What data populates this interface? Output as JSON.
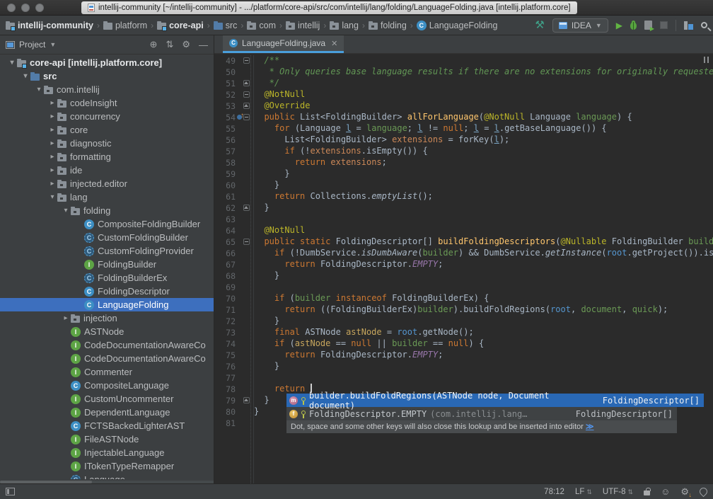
{
  "window": {
    "title": "intellij-community [~/intellij-community] - .../platform/core-api/src/com/intellij/lang/folding/LanguageFolding.java [intellij.platform.core]"
  },
  "navbar": {
    "crumbs": [
      {
        "label": "intellij-community",
        "icon": "module",
        "bold": true
      },
      {
        "label": "platform",
        "icon": "folder",
        "bold": false
      },
      {
        "label": "core-api",
        "icon": "module",
        "bold": true
      },
      {
        "label": "src",
        "icon": "folder-src",
        "bold": false
      },
      {
        "label": "com",
        "icon": "package",
        "bold": false
      },
      {
        "label": "intellij",
        "icon": "package",
        "bold": false
      },
      {
        "label": "lang",
        "icon": "package",
        "bold": false
      },
      {
        "label": "folding",
        "icon": "package",
        "bold": false
      },
      {
        "label": "LanguageFolding",
        "icon": "class",
        "bold": false
      }
    ],
    "run_config": "IDEA",
    "toolbar_icons": [
      "build-hammer-icon",
      "run-config-chip",
      "run-icon",
      "debug-icon",
      "coverage-icon",
      "stop-icon",
      "project-structure-icon",
      "search-icon"
    ]
  },
  "project_panel": {
    "header": {
      "title": "Project",
      "icons": [
        "locate-icon",
        "collapse-all-icon",
        "settings-gear-icon",
        "hide-icon"
      ]
    },
    "tree": [
      {
        "label": "core-api [intellij.platform.core]",
        "icon": "module",
        "level": 0,
        "arrow": "expanded",
        "bold": true,
        "selected": false
      },
      {
        "label": "src",
        "icon": "folder-src",
        "level": 1,
        "arrow": "expanded",
        "bold": true,
        "selected": false
      },
      {
        "label": "com.intellij",
        "icon": "package",
        "level": 2,
        "arrow": "expanded",
        "bold": false,
        "selected": false
      },
      {
        "label": "codeInsight",
        "icon": "package",
        "level": 3,
        "arrow": "collapsed",
        "bold": false,
        "selected": false
      },
      {
        "label": "concurrency",
        "icon": "package",
        "level": 3,
        "arrow": "collapsed",
        "bold": false,
        "selected": false
      },
      {
        "label": "core",
        "icon": "package",
        "level": 3,
        "arrow": "collapsed",
        "bold": false,
        "selected": false
      },
      {
        "label": "diagnostic",
        "icon": "package",
        "level": 3,
        "arrow": "collapsed",
        "bold": false,
        "selected": false
      },
      {
        "label": "formatting",
        "icon": "package",
        "level": 3,
        "arrow": "collapsed",
        "bold": false,
        "selected": false
      },
      {
        "label": "ide",
        "icon": "package",
        "level": 3,
        "arrow": "collapsed",
        "bold": false,
        "selected": false
      },
      {
        "label": "injected.editor",
        "icon": "package",
        "level": 3,
        "arrow": "collapsed",
        "bold": false,
        "selected": false
      },
      {
        "label": "lang",
        "icon": "package",
        "level": 3,
        "arrow": "expanded",
        "bold": false,
        "selected": false
      },
      {
        "label": "folding",
        "icon": "package",
        "level": 4,
        "arrow": "expanded",
        "bold": false,
        "selected": false
      },
      {
        "label": "CompositeFoldingBuilder",
        "icon": "class",
        "level": 5,
        "arrow": "none",
        "bold": false,
        "selected": false
      },
      {
        "label": "CustomFoldingBuilder",
        "icon": "class-abstract",
        "level": 5,
        "arrow": "none",
        "bold": false,
        "selected": false
      },
      {
        "label": "CustomFoldingProvider",
        "icon": "class-abstract",
        "level": 5,
        "arrow": "none",
        "bold": false,
        "selected": false
      },
      {
        "label": "FoldingBuilder",
        "icon": "interface",
        "level": 5,
        "arrow": "none",
        "bold": false,
        "selected": false
      },
      {
        "label": "FoldingBuilderEx",
        "icon": "class-abstract",
        "level": 5,
        "arrow": "none",
        "bold": false,
        "selected": false
      },
      {
        "label": "FoldingDescriptor",
        "icon": "class",
        "level": 5,
        "arrow": "none",
        "bold": false,
        "selected": false
      },
      {
        "label": "LanguageFolding",
        "icon": "class",
        "level": 5,
        "arrow": "none",
        "bold": false,
        "selected": true
      },
      {
        "label": "injection",
        "icon": "package",
        "level": 4,
        "arrow": "collapsed",
        "bold": false,
        "selected": false
      },
      {
        "label": "ASTNode",
        "icon": "interface",
        "level": 4,
        "arrow": "none",
        "bold": false,
        "selected": false
      },
      {
        "label": "CodeDocumentationAwareCo",
        "icon": "interface",
        "level": 4,
        "arrow": "none",
        "bold": false,
        "selected": false
      },
      {
        "label": "CodeDocumentationAwareCo",
        "icon": "interface",
        "level": 4,
        "arrow": "none",
        "bold": false,
        "selected": false
      },
      {
        "label": "Commenter",
        "icon": "interface",
        "level": 4,
        "arrow": "none",
        "bold": false,
        "selected": false
      },
      {
        "label": "CompositeLanguage",
        "icon": "class",
        "level": 4,
        "arrow": "none",
        "bold": false,
        "selected": false
      },
      {
        "label": "CustomUncommenter",
        "icon": "interface",
        "level": 4,
        "arrow": "none",
        "bold": false,
        "selected": false
      },
      {
        "label": "DependentLanguage",
        "icon": "interface",
        "level": 4,
        "arrow": "none",
        "bold": false,
        "selected": false
      },
      {
        "label": "FCTSBackedLighterAST",
        "icon": "class",
        "level": 4,
        "arrow": "none",
        "bold": false,
        "selected": false
      },
      {
        "label": "FileASTNode",
        "icon": "interface",
        "level": 4,
        "arrow": "none",
        "bold": false,
        "selected": false
      },
      {
        "label": "InjectableLanguage",
        "icon": "interface",
        "level": 4,
        "arrow": "none",
        "bold": false,
        "selected": false
      },
      {
        "label": "ITokenTypeRemapper",
        "icon": "interface",
        "level": 4,
        "arrow": "none",
        "bold": false,
        "selected": false
      },
      {
        "label": "Language",
        "icon": "class-abstract",
        "level": 4,
        "arrow": "none",
        "bold": false,
        "selected": false
      }
    ]
  },
  "editor": {
    "tab": {
      "label": "LanguageFolding.java"
    },
    "lines": [
      {
        "n": 49,
        "fold": "s",
        "tokens": [
          [
            "  /**",
            "d"
          ]
        ]
      },
      {
        "n": 50,
        "fold": "",
        "tokens": [
          [
            "   * Only queries base language results if there are no extensions for originally requested",
            "d"
          ]
        ]
      },
      {
        "n": 51,
        "fold": "e",
        "tokens": [
          [
            "   */",
            "d"
          ]
        ]
      },
      {
        "n": 52,
        "fold": "s",
        "tokens": [
          [
            "  ",
            "p"
          ],
          [
            "@NotNull",
            "a"
          ]
        ]
      },
      {
        "n": 53,
        "fold": "e",
        "tokens": [
          [
            "  ",
            "p"
          ],
          [
            "@Override",
            "a"
          ]
        ]
      },
      {
        "n": 54,
        "fold": "s",
        "override": true,
        "tokens": [
          [
            "  ",
            "p"
          ],
          [
            "public",
            "k"
          ],
          [
            " List<FoldingBuilder> ",
            "p"
          ],
          [
            "allForLanguage",
            "m"
          ],
          [
            "(",
            "p"
          ],
          [
            "@NotNull",
            "a"
          ],
          [
            " Language ",
            "p"
          ],
          [
            "language",
            "g"
          ],
          [
            ") {",
            "p"
          ]
        ]
      },
      {
        "n": 55,
        "fold": "",
        "tokens": [
          [
            "    ",
            "p"
          ],
          [
            "for",
            "k"
          ],
          [
            " (Language ",
            "p"
          ],
          [
            "l",
            "t"
          ],
          [
            " = ",
            "p"
          ],
          [
            "language",
            "g"
          ],
          [
            "; ",
            "p"
          ],
          [
            "l",
            "t"
          ],
          [
            " != ",
            "p"
          ],
          [
            "null",
            "k"
          ],
          [
            "; ",
            "p"
          ],
          [
            "l",
            "t"
          ],
          [
            " = ",
            "p"
          ],
          [
            "l",
            "t"
          ],
          [
            ".getBaseLanguage()) {",
            "p"
          ]
        ]
      },
      {
        "n": 56,
        "fold": "",
        "tokens": [
          [
            "      List<FoldingBuilder> ",
            "p"
          ],
          [
            "extensions",
            "o"
          ],
          [
            " = forKey(",
            "p"
          ],
          [
            "l",
            "t"
          ],
          [
            ");",
            "p"
          ]
        ]
      },
      {
        "n": 57,
        "fold": "",
        "tokens": [
          [
            "      ",
            "p"
          ],
          [
            "if",
            "k"
          ],
          [
            " (!",
            "p"
          ],
          [
            "extensions",
            "o"
          ],
          [
            ".isEmpty()) {",
            "p"
          ]
        ]
      },
      {
        "n": 58,
        "fold": "",
        "tokens": [
          [
            "        ",
            "p"
          ],
          [
            "return",
            "k"
          ],
          [
            " ",
            "p"
          ],
          [
            "extensions",
            "o"
          ],
          [
            ";",
            "p"
          ]
        ]
      },
      {
        "n": 59,
        "fold": "",
        "tokens": [
          [
            "      }",
            "p"
          ]
        ]
      },
      {
        "n": 60,
        "fold": "",
        "tokens": [
          [
            "    }",
            "p"
          ]
        ]
      },
      {
        "n": 61,
        "fold": "",
        "tokens": [
          [
            "    ",
            "p"
          ],
          [
            "return",
            "k"
          ],
          [
            " Collections.",
            "p"
          ],
          [
            "emptyList",
            "i"
          ],
          [
            "();",
            "p"
          ]
        ]
      },
      {
        "n": 62,
        "fold": "e",
        "tokens": [
          [
            "  }",
            "p"
          ]
        ]
      },
      {
        "n": 63,
        "fold": "",
        "tokens": []
      },
      {
        "n": 64,
        "fold": "",
        "tokens": [
          [
            "  ",
            "p"
          ],
          [
            "@NotNull",
            "a"
          ]
        ]
      },
      {
        "n": 65,
        "fold": "s",
        "tokens": [
          [
            "  ",
            "p"
          ],
          [
            "public static",
            "k"
          ],
          [
            " FoldingDescriptor[] ",
            "p"
          ],
          [
            "buildFoldingDescriptors",
            "m"
          ],
          [
            "(",
            "p"
          ],
          [
            "@Nullable",
            "a"
          ],
          [
            " FoldingBuilder ",
            "p"
          ],
          [
            "builder",
            "g"
          ]
        ]
      },
      {
        "n": 66,
        "fold": "",
        "tokens": [
          [
            "    ",
            "p"
          ],
          [
            "if",
            "k"
          ],
          [
            " (!DumbService.",
            "p"
          ],
          [
            "isDumbAware",
            "i"
          ],
          [
            "(",
            "p"
          ],
          [
            "builder",
            "g"
          ],
          [
            ") && DumbService.",
            "p"
          ],
          [
            "getInstance",
            "i"
          ],
          [
            "(",
            "p"
          ],
          [
            "root",
            "b"
          ],
          [
            ".getProject()).isDu",
            "p"
          ]
        ]
      },
      {
        "n": 67,
        "fold": "",
        "tokens": [
          [
            "      ",
            "p"
          ],
          [
            "return",
            "k"
          ],
          [
            " FoldingDescriptor.",
            "p"
          ],
          [
            "EMPTY",
            "c"
          ],
          [
            ";",
            "p"
          ]
        ]
      },
      {
        "n": 68,
        "fold": "",
        "tokens": [
          [
            "    }",
            "p"
          ]
        ]
      },
      {
        "n": 69,
        "fold": "",
        "tokens": []
      },
      {
        "n": 70,
        "fold": "",
        "tokens": [
          [
            "    ",
            "p"
          ],
          [
            "if",
            "k"
          ],
          [
            " (",
            "p"
          ],
          [
            "builder",
            "g"
          ],
          [
            " ",
            "p"
          ],
          [
            "instanceof",
            "k"
          ],
          [
            " FoldingBuilderEx) {",
            "p"
          ]
        ]
      },
      {
        "n": 71,
        "fold": "",
        "tokens": [
          [
            "      ",
            "p"
          ],
          [
            "return",
            "k"
          ],
          [
            " ((FoldingBuilderEx)",
            "p"
          ],
          [
            "builder",
            "g"
          ],
          [
            ").buildFoldRegions(",
            "p"
          ],
          [
            "root",
            "b"
          ],
          [
            ", ",
            "p"
          ],
          [
            "document",
            "g"
          ],
          [
            ", ",
            "p"
          ],
          [
            "quick",
            "g"
          ],
          [
            ");",
            "p"
          ]
        ]
      },
      {
        "n": 72,
        "fold": "",
        "tokens": [
          [
            "    }",
            "p"
          ]
        ]
      },
      {
        "n": 73,
        "fold": "",
        "tokens": [
          [
            "    ",
            "p"
          ],
          [
            "final",
            "k"
          ],
          [
            " ASTNode ",
            "p"
          ],
          [
            "astNode",
            "y"
          ],
          [
            " = ",
            "p"
          ],
          [
            "root",
            "b"
          ],
          [
            ".getNode();",
            "p"
          ]
        ]
      },
      {
        "n": 74,
        "fold": "",
        "tokens": [
          [
            "    ",
            "p"
          ],
          [
            "if",
            "k"
          ],
          [
            " (",
            "p"
          ],
          [
            "astNode",
            "y"
          ],
          [
            " == ",
            "p"
          ],
          [
            "null",
            "k"
          ],
          [
            " || ",
            "p"
          ],
          [
            "builder",
            "g"
          ],
          [
            " == ",
            "p"
          ],
          [
            "null",
            "k"
          ],
          [
            ") {",
            "p"
          ]
        ]
      },
      {
        "n": 75,
        "fold": "",
        "tokens": [
          [
            "      ",
            "p"
          ],
          [
            "return",
            "k"
          ],
          [
            " FoldingDescriptor.",
            "p"
          ],
          [
            "EMPTY",
            "c"
          ],
          [
            ";",
            "p"
          ]
        ]
      },
      {
        "n": 76,
        "fold": "",
        "tokens": [
          [
            "    }",
            "p"
          ]
        ]
      },
      {
        "n": 77,
        "fold": "",
        "tokens": []
      },
      {
        "n": 78,
        "fold": "",
        "cursor": true,
        "tokens": [
          [
            "    ",
            "p"
          ],
          [
            "return",
            "k"
          ],
          [
            " ",
            "p"
          ]
        ]
      },
      {
        "n": 79,
        "fold": "e",
        "tokens": [
          [
            "  }",
            "p"
          ]
        ]
      },
      {
        "n": 80,
        "fold": "",
        "tokens": [
          [
            "}",
            "p"
          ]
        ]
      },
      {
        "n": 81,
        "fold": "",
        "tokens": []
      }
    ]
  },
  "popup": {
    "rows": [
      {
        "kind": "method",
        "text": "builder.buildFoldRegions(ASTNode node, Document document)",
        "tail": "",
        "type": "FoldingDescriptor[]",
        "selected": true
      },
      {
        "kind": "field",
        "text": "FoldingDescriptor.EMPTY",
        "tail": " (com.intellij.lang…",
        "type": "FoldingDescriptor[]",
        "selected": false
      }
    ],
    "hint": "Dot, space and some other keys will also close this lookup and be inserted into editor ",
    "hint_link": "≫"
  },
  "statusbar": {
    "position": "78:12",
    "line_ending": "LF",
    "encoding": "UTF-8"
  },
  "colors": {
    "accent_selection": "#3d6fbe",
    "popup_selection": "#2968b5",
    "tab_underline": "#4a9edb",
    "editor_background": "#2b2b2b",
    "panel_background": "#3c3f41"
  }
}
